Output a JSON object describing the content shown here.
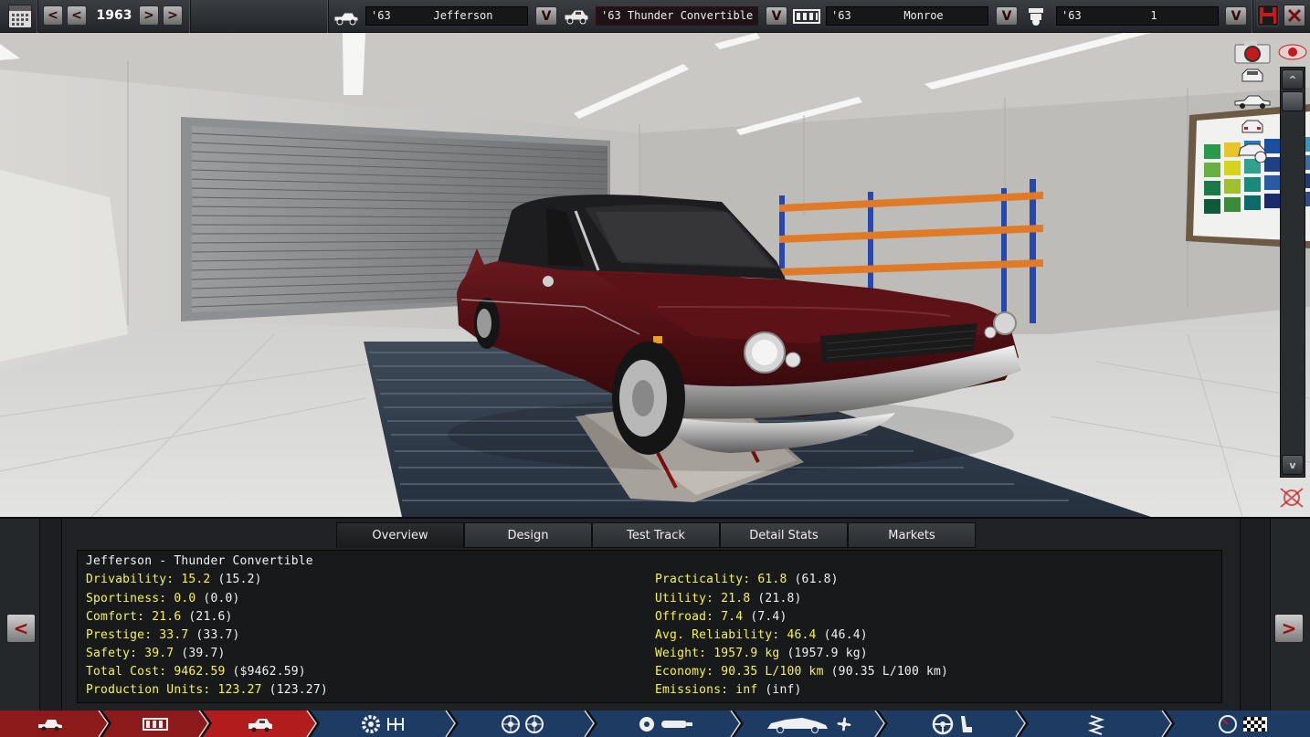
{
  "toolbar": {
    "year": "1963",
    "prev_arrow": "<",
    "next_arrow": ">",
    "dropdown_arrow": "V",
    "model": {
      "year": "'63",
      "name": "Jefferson"
    },
    "trim": {
      "name": "'63 Thunder Convertible"
    },
    "chassis": {
      "year": "'63",
      "name": "Monroe"
    },
    "engine": {
      "year": "'63",
      "name": "1"
    }
  },
  "tabs": [
    "Overview",
    "Design",
    "Test Track",
    "Detail Stats",
    "Markets"
  ],
  "active_tab": "Overview",
  "overview": {
    "title": "Jefferson - Thunder Convertible",
    "left": [
      {
        "label": "Drivability: 15.2",
        "paren": " (15.2)"
      },
      {
        "label": "Sportiness: 0.0",
        "paren": " (0.0)"
      },
      {
        "label": "Comfort: 21.6",
        "paren": " (21.6)"
      },
      {
        "label": "Prestige: 33.7",
        "paren": " (33.7)"
      },
      {
        "label": "Safety: 39.7",
        "paren": " (39.7)"
      },
      {
        "label": "Total Cost: 9462.59",
        "paren": " ($9462.59)"
      },
      {
        "label": "Production Units: 123.27",
        "paren": " (123.27)"
      }
    ],
    "right": [
      {
        "label": "Practicality: 61.8",
        "paren": " (61.8)"
      },
      {
        "label": "Utility: 21.8",
        "paren": " (21.8)"
      },
      {
        "label": "Offroad: 7.4",
        "paren": " (7.4)"
      },
      {
        "label": "Avg. Reliability: 46.4",
        "paren": " (46.4)"
      },
      {
        "label": "Weight: 1957.9 kg",
        "paren": " (1957.9 kg)"
      },
      {
        "label": "Economy: 90.35 L/100 km",
        "paren": " (90.35 L/100 km)"
      },
      {
        "label": "Emissions: inf",
        "paren": " (inf)"
      }
    ]
  },
  "scroll": {
    "up": "^",
    "down": "v"
  },
  "panel_nav": {
    "prev": "<",
    "next": ">"
  },
  "icons": {
    "calendar": "calendar-icon",
    "car_model": "car-model-icon",
    "trim": "car-trim-icon",
    "chassis": "chassis-icon",
    "engine": "engine-icon",
    "save": "save-icon",
    "close": "close-icon",
    "camera": "camera-icon",
    "eye": "eye-icon"
  },
  "colors": {
    "accent_red": "#c41a1a",
    "stat_label": "#f7f54a",
    "active_bottom_tab": "#a31a1a",
    "bottom_tab_blue": "#1e3c63"
  }
}
